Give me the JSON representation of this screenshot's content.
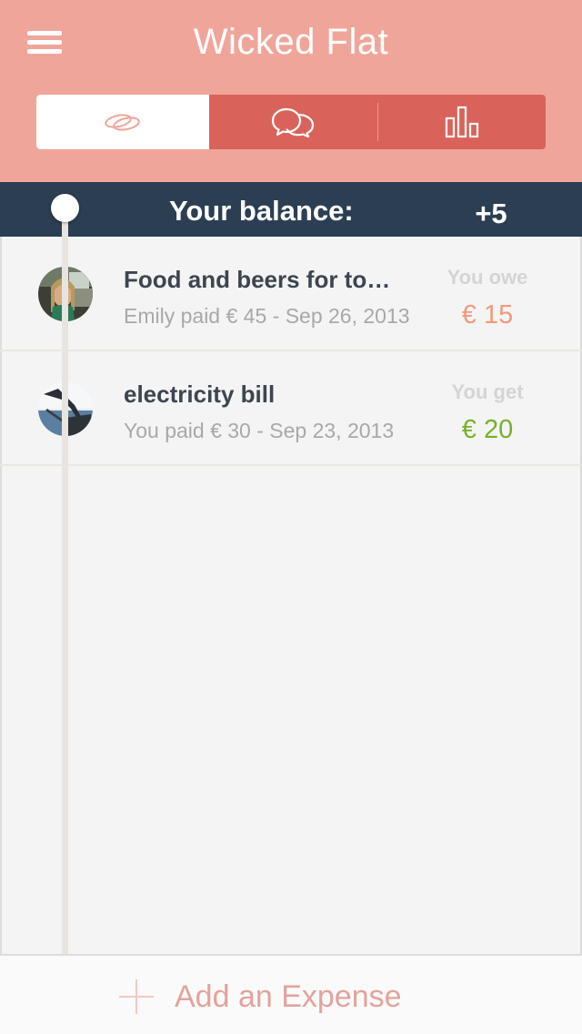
{
  "header": {
    "title": "Wicked Flat",
    "tabs": [
      {
        "icon": "rings-icon",
        "active": true
      },
      {
        "icon": "chat-bubbles-icon",
        "active": false
      },
      {
        "icon": "bar-chart-icon",
        "active": false
      }
    ]
  },
  "balance": {
    "label": "Your balance:",
    "value": "+5"
  },
  "expenses": [
    {
      "title": "Food and beers for to…",
      "subtitle": "Emily paid € 45 - Sep 26, 2013",
      "kind": "You owe",
      "amount": "€ 15",
      "status": "owe"
    },
    {
      "title": "electricity bill",
      "subtitle": "You paid € 30 - Sep 23, 2013",
      "kind": "You get",
      "amount": "€ 20",
      "status": "get"
    }
  ],
  "footer": {
    "add_label": "Add an Expense"
  },
  "colors": {
    "header": "#f0a59a",
    "segment": "#d9635a",
    "balance_bar": "#2c3e52",
    "owe": "#f2987c",
    "get": "#7ab02c"
  }
}
